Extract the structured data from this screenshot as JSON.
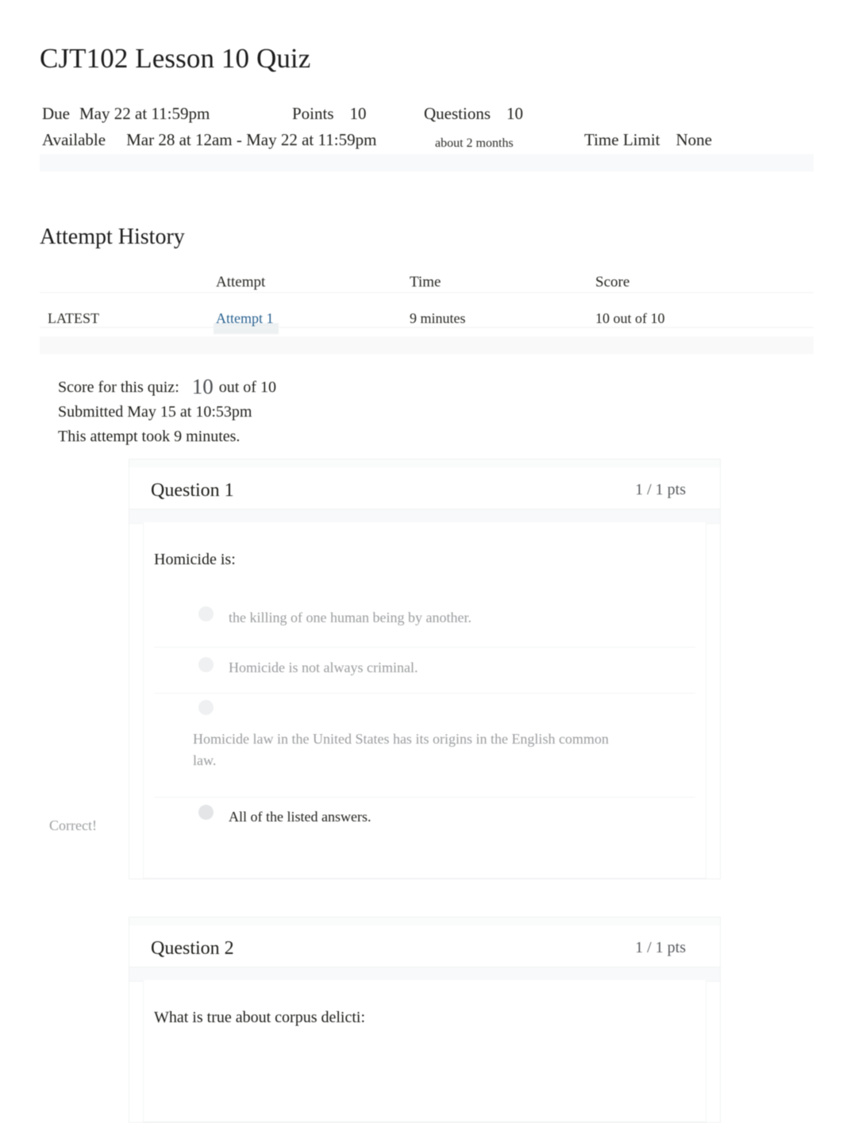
{
  "quiz": {
    "title": "CJT102 Lesson 10 Quiz",
    "meta": {
      "due_label": "Due",
      "due_value": "May 22 at 11:59pm",
      "points_label": "Points",
      "points_value": "10",
      "questions_label": "Questions",
      "questions_value": "10",
      "available_label": "Available",
      "available_value": "Mar 28 at 12am - May 22 at 11:59pm",
      "duration_value": "about 2 months",
      "time_limit_label": "Time Limit",
      "time_limit_value": "None"
    }
  },
  "attempt_history": {
    "heading": "Attempt History",
    "columns": [
      "",
      "Attempt",
      "Time",
      "Score"
    ],
    "rows": [
      {
        "kept": "LATEST",
        "attempt": "Attempt 1",
        "time": "9 minutes",
        "score": "10 out of 10"
      }
    ]
  },
  "score_summary": {
    "score_label": "Score for this quiz:",
    "score_value": "10",
    "out_of": "out of 10",
    "submitted": "Submitted May 15 at 10:53pm",
    "duration": "This attempt took 9 minutes."
  },
  "questions": [
    {
      "name": "Question 1",
      "points": "1 / 1 pts",
      "text": "Homicide is:",
      "correct_label": "Correct!",
      "answers": [
        {
          "text": "the killing of one human being by another.",
          "selected": false
        },
        {
          "text": "Homicide is not always criminal.",
          "selected": false
        },
        {
          "text": "Homicide law in the United States has its origins in the English common law.",
          "selected": false
        },
        {
          "text": "All of the listed answers.",
          "selected": true
        }
      ]
    },
    {
      "name": "Question 2",
      "points": "1 / 1 pts",
      "text": "What is true about corpus delicti:",
      "answers": []
    }
  ],
  "colors": {
    "link": "#27608f",
    "muted_text": "#9a9c9e",
    "body_text": "#1d1e1a",
    "card_border": "#f0f1f2",
    "band": "#f7f8f9"
  }
}
